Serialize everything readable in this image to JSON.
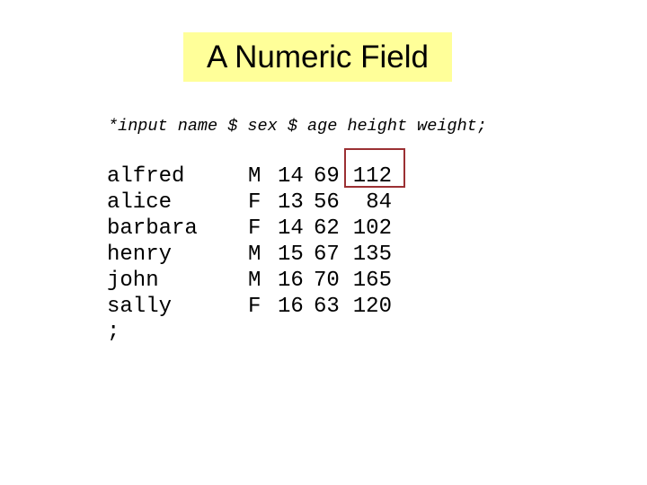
{
  "title": "A Numeric Field",
  "input_statement": "*input name $ sex $ age height weight;",
  "highlight_color": "#9b3033",
  "title_background": "#ffff99",
  "rows": [
    {
      "name": "alfred",
      "sex": "M",
      "age": "14",
      "height": "69",
      "weight": "112"
    },
    {
      "name": "alice",
      "sex": "F",
      "age": "13",
      "height": "56",
      "weight": "84"
    },
    {
      "name": "barbara",
      "sex": "F",
      "age": "14",
      "height": "62",
      "weight": "102"
    },
    {
      "name": "henry",
      "sex": "M",
      "age": "15",
      "height": "67",
      "weight": "135"
    },
    {
      "name": "john",
      "sex": "M",
      "age": "16",
      "height": "70",
      "weight": "165"
    },
    {
      "name": "sally",
      "sex": "F",
      "age": "16",
      "height": "63",
      "weight": "120"
    }
  ],
  "terminator": ";",
  "highlighted_field": "weight of first row"
}
